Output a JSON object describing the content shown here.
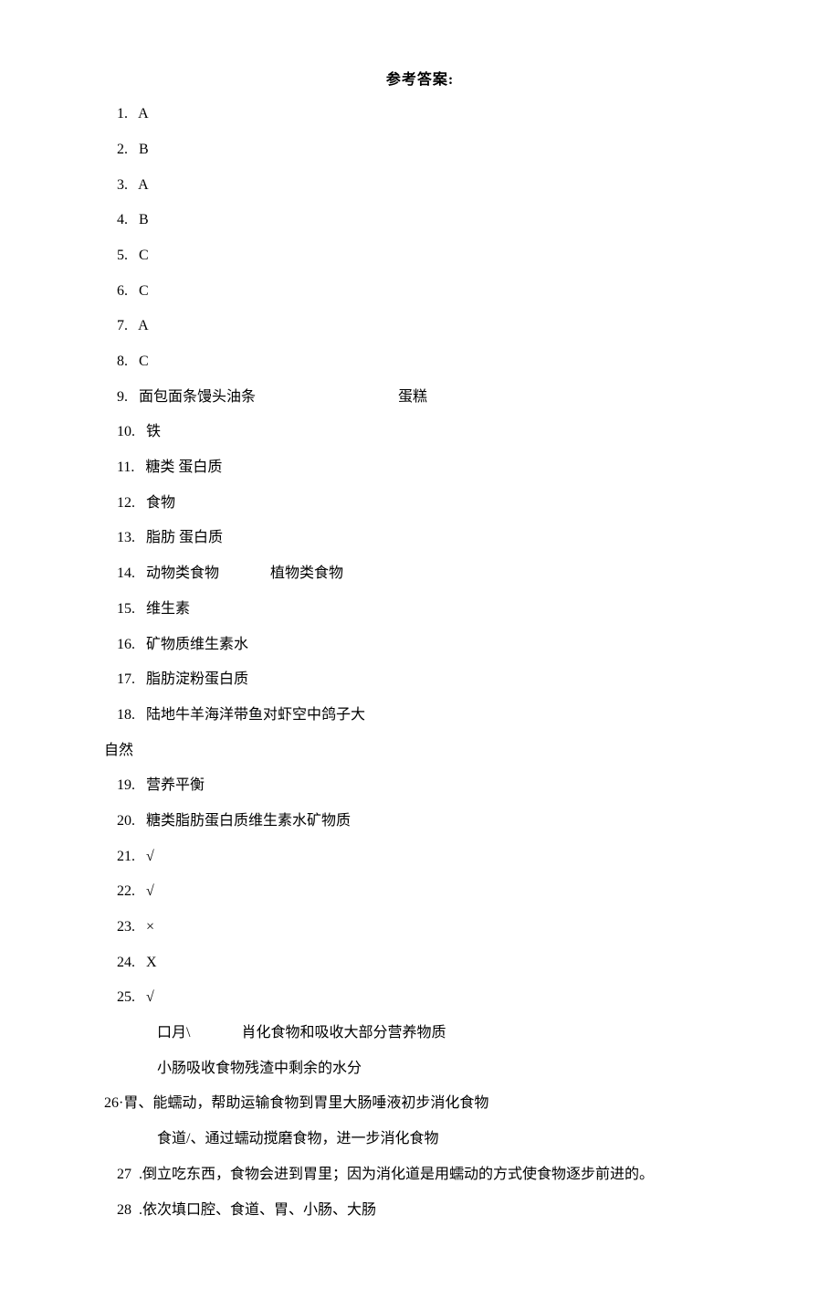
{
  "title": "参考答案:",
  "answers": {
    "a1": "1.   A",
    "a2": "2.   B",
    "a3": "3.   A",
    "a4": "4.   B",
    "a5": "5.   C",
    "a6": "6.   C",
    "a7": "7.   A",
    "a8": "8.   C",
    "a9": "9.   面包面条馒头油条                                       蛋糕",
    "a10": "10.   铁",
    "a11": "11.   糖类 蛋白质",
    "a12": "12.   食物",
    "a13": "13.   脂肪 蛋白质",
    "a14": "14.   动物类食物              植物类食物",
    "a15": "15.   维生素",
    "a16": "16.   矿物质维生素水",
    "a17": "17.   脂肪淀粉蛋白质",
    "a18": "18.   陆地牛羊海洋带鱼对虾空中鸽子大",
    "a18b": "自然",
    "a19": "19.   营养平衡",
    "a20": "20.   糖类脂肪蛋白质维生素水矿物质",
    "a21": "21.   √",
    "a22": "22.   √",
    "a23": "23.   ×",
    "a24": "24.   X",
    "a25": "25.   √",
    "a26a": "口月\\              肖化食物和吸收大部分营养物质",
    "a26b": "小肠吸收食物残渣中剩余的水分",
    "a26c": "26·胃、能蠕动，帮助运输食物到胃里大肠唾液初步消化食物",
    "a26d": "食道/、通过蠕动搅磨食物，进一步消化食物",
    "a27": "27  .倒立吃东西，食物会进到胃里；因为消化道是用蠕动的方式使食物逐步前进的。",
    "a28": "28  .依次填口腔、食道、胃、小肠、大肠"
  }
}
